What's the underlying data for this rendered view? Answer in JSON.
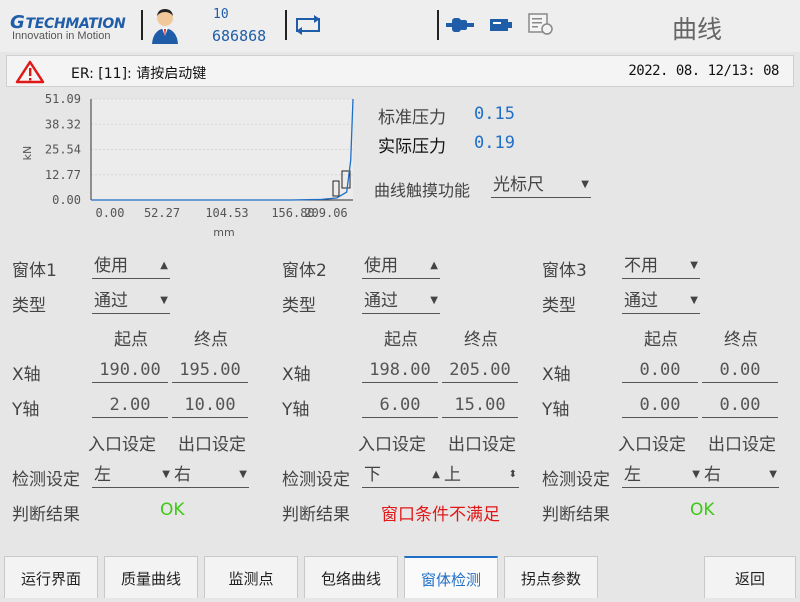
{
  "header": {
    "logo_brand": "TECHMATION",
    "logo_tagline": "Innovation in Motion",
    "user_level": "10",
    "user_id": "686868",
    "page_title": "曲线"
  },
  "alarm": {
    "message": "ER: [11]: 请按启动键",
    "datetime": "2022. 08. 12/13: 08"
  },
  "pressure": {
    "standard_label": "标准压力",
    "standard_value": "0.15",
    "actual_label": "实际压力",
    "actual_value": "0.19",
    "touch_label": "曲线触摸功能",
    "touch_value": "光标尺"
  },
  "chart_data": {
    "type": "line",
    "ylabel": "kN",
    "xlabel": "mm",
    "y_ticks": [
      "51.09",
      "38.32",
      "25.54",
      "12.77",
      "0.00"
    ],
    "x_ticks": [
      "0.00",
      "52.27",
      "104.53",
      "156.80",
      "209.06"
    ],
    "xlim": [
      0,
      261.3
    ],
    "ylim": [
      0,
      51.09
    ],
    "series": [
      {
        "x": [
          0,
          180,
          200,
          230,
          245,
          255,
          259,
          261.3
        ],
        "y": [
          0,
          0,
          0,
          0.3,
          1.0,
          4.0,
          20.0,
          51.09
        ]
      }
    ],
    "windows": [
      {
        "x": [
          198,
          205
        ],
        "y": [
          6,
          15
        ]
      },
      {
        "x": [
          190,
          195
        ],
        "y": [
          2,
          10
        ]
      }
    ]
  },
  "windows": [
    {
      "title": "窗体1",
      "usage": "使用",
      "usage_arrow": "▲",
      "type_label": "类型",
      "type": "通过",
      "start_label": "起点",
      "end_label": "终点",
      "x_label": "X轴",
      "x_start": "190.00",
      "x_end": "195.00",
      "y_label": "Y轴",
      "y_start": "2.00",
      "y_end": "10.00",
      "entry_label": "入口设定",
      "exit_label": "出口设定",
      "detect_label": "检测设定",
      "entry": "左",
      "entry_arrow": "▼",
      "exit": "右",
      "exit_arrow": "▼",
      "result_label": "判断结果",
      "result": "OK"
    },
    {
      "title": "窗体2",
      "usage": "使用",
      "usage_arrow": "▲",
      "type_label": "类型",
      "type": "通过",
      "start_label": "起点",
      "end_label": "终点",
      "x_label": "X轴",
      "x_start": "198.00",
      "x_end": "205.00",
      "y_label": "Y轴",
      "y_start": "6.00",
      "y_end": "15.00",
      "entry_label": "入口设定",
      "exit_label": "出口设定",
      "detect_label": "检测设定",
      "entry": "下",
      "entry_arrow": "▲",
      "exit": "上",
      "exit_arrow": "⬍",
      "result_label": "判断结果",
      "result": "窗口条件不满足"
    },
    {
      "title": "窗体3",
      "usage": "不用",
      "usage_arrow": "▼",
      "type_label": "类型",
      "type": "通过",
      "start_label": "起点",
      "end_label": "终点",
      "x_label": "X轴",
      "x_start": "0.00",
      "x_end": "0.00",
      "y_label": "Y轴",
      "y_start": "0.00",
      "y_end": "0.00",
      "entry_label": "入口设定",
      "exit_label": "出口设定",
      "detect_label": "检测设定",
      "entry": "左",
      "entry_arrow": "▼",
      "exit": "右",
      "exit_arrow": "▼",
      "result_label": "判断结果",
      "result": "OK"
    }
  ],
  "nav": {
    "run": "运行界面",
    "quality": "质量曲线",
    "monitor": "监测点",
    "envelope": "包络曲线",
    "window_detect": "窗体检测",
    "inflection": "拐点参数",
    "back": "返回"
  },
  "colors": {
    "accent": "#1f6fc7",
    "ok": "#3ec816",
    "fail": "#e01818",
    "alarm": "#e01818"
  }
}
